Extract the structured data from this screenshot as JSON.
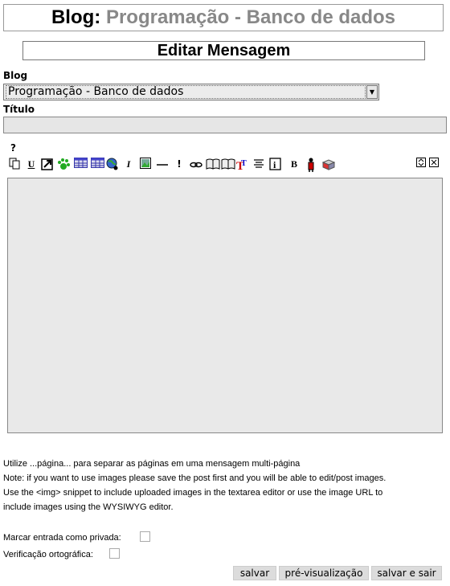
{
  "header": {
    "prefix": "Blog:",
    "blog_name": "Programação - Banco de dados"
  },
  "subheader": {
    "title": "Editar Mensagem"
  },
  "form": {
    "blog_label": "Blog",
    "blog_selected": "Programação - Banco de dados",
    "titulo_label": "Título",
    "titulo_value": "",
    "help": "?"
  },
  "toolbar": {
    "icons": [
      "copy-icon",
      "underline-icon",
      "external-link-icon",
      "paw-icon",
      "table-icon",
      "table-alt-icon",
      "globe-icon",
      "italic-icon",
      "image-icon",
      "horizontal-rule-icon",
      "exclamation-icon",
      "link-icon",
      "book-icon",
      "book-open-icon",
      "text-color-icon",
      "align-center-icon",
      "info-icon",
      "bold-icon",
      "person-icon",
      "package-icon",
      "resize-icon",
      "close-icon"
    ]
  },
  "notes": {
    "line1": "Utilize ...página... para separar as páginas em uma mensagem multi-página",
    "line2": "Note: if you want to use images please save the post first and you will be able to edit/post images.",
    "line3": "Use the <img> snippet to include uploaded images in the textarea editor or use the image URL to",
    "line4": "include images using the WYSIWYG editor."
  },
  "options": {
    "private_label": "Marcar entrada como privada:",
    "spellcheck_label": "Verificação ortográfica:"
  },
  "buttons": {
    "save": "salvar",
    "preview": "pré-visualização",
    "save_exit": "salvar e sair"
  }
}
